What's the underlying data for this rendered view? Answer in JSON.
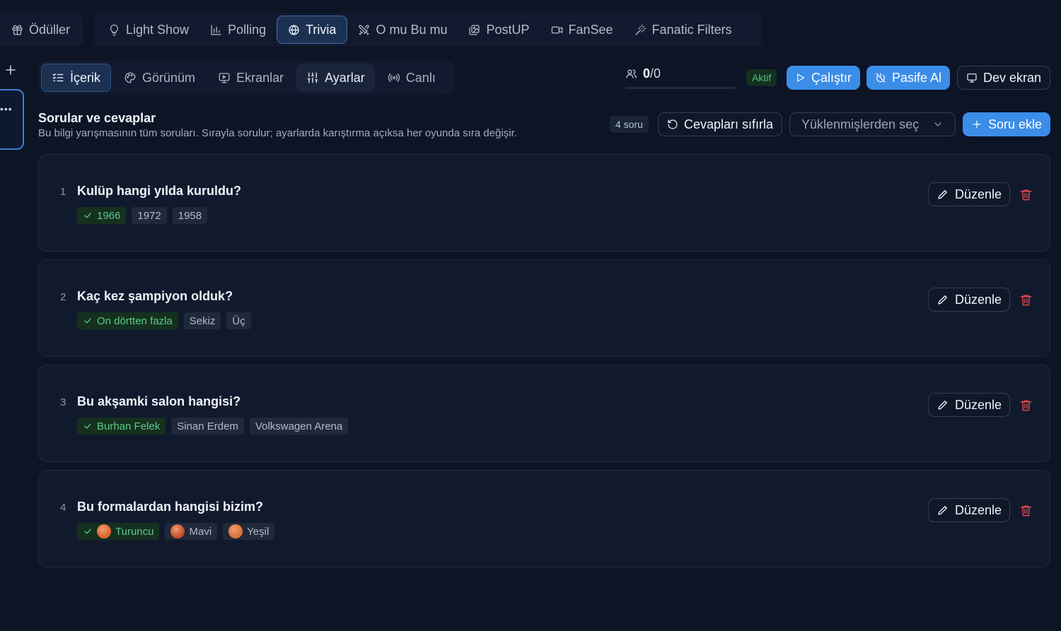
{
  "top_tabs": [
    {
      "label": "Ödüller",
      "icon": "gift-icon"
    },
    {
      "label": "Light Show",
      "icon": "lightbulb-icon"
    },
    {
      "label": "Polling",
      "icon": "bar-chart-icon"
    },
    {
      "label": "Trivia",
      "icon": "globe-icon",
      "active": true
    },
    {
      "label": "O mu Bu mu",
      "icon": "swords-icon"
    },
    {
      "label": "PostUP",
      "icon": "image-icon"
    },
    {
      "label": "FanSee",
      "icon": "video-icon"
    },
    {
      "label": "Fanatic Filters",
      "icon": "magic-wand-icon"
    }
  ],
  "sub_tabs": [
    {
      "label": "İçerik",
      "icon": "list-check-icon",
      "active": true
    },
    {
      "label": "Görünüm",
      "icon": "palette-icon"
    },
    {
      "label": "Ekranlar",
      "icon": "monitor-play-icon"
    },
    {
      "label": "Ayarlar",
      "icon": "sliders-icon"
    },
    {
      "label": "Canlı",
      "icon": "radio-signal-icon"
    }
  ],
  "participants": {
    "current": "0",
    "total": "/0",
    "progress": 0
  },
  "status_badge": "Aktif",
  "actions": {
    "run": "Çalıştır",
    "deactivate": "Pasife Al",
    "big_screen": "Dev ekran"
  },
  "section": {
    "title": "Sorular ve cevaplar",
    "subtitle": "Bu bilgi yarışmasının tüm soruları. Sırayla sorulur; ayarlarda karıştırma açıksa her oyunda sıra değişir.",
    "count": "4 soru",
    "reset_answers": "Cevapları sıfırla",
    "select_placeholder": "Yüklenmişlerden seç",
    "add_question": "Soru ekle"
  },
  "edit_label": "Düzenle",
  "questions": [
    {
      "num": "1",
      "text": "Kulüp hangi yılda kuruldu?",
      "options": [
        {
          "label": "1966",
          "correct": true
        },
        {
          "label": "1972"
        },
        {
          "label": "1958"
        }
      ]
    },
    {
      "num": "2",
      "text": "Kaç kez şampiyon olduk?",
      "options": [
        {
          "label": "On dörtten fazla",
          "correct": true
        },
        {
          "label": "Sekiz"
        },
        {
          "label": "Üç"
        }
      ]
    },
    {
      "num": "3",
      "text": "Bu akşamki salon hangisi?",
      "options": [
        {
          "label": "Burhan Felek",
          "correct": true
        },
        {
          "label": "Sinan Erdem"
        },
        {
          "label": "Volkswagen Arena"
        }
      ]
    },
    {
      "num": "4",
      "text": "Bu formalardan hangisi bizim?",
      "options": [
        {
          "label": "Turuncu",
          "correct": true,
          "swatch": "#e0662f"
        },
        {
          "label": "Mavi",
          "swatch": "#c8502c"
        },
        {
          "label": "Yeşil",
          "swatch": "#d9743a"
        }
      ]
    }
  ],
  "colors": {
    "background": "#0c1426",
    "accent": "#3b8de8",
    "success": "#4fc47c",
    "danger": "#e5484d"
  }
}
